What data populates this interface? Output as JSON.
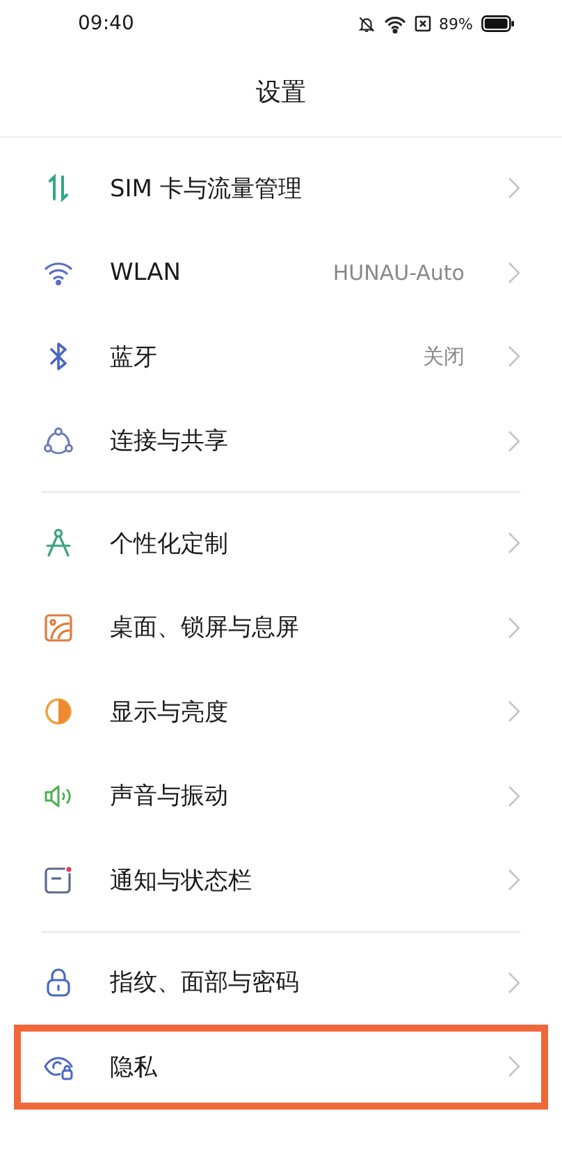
{
  "status_bar": {
    "time": "09:40",
    "battery": "89%"
  },
  "title": "设置",
  "groups": [
    {
      "items": [
        {
          "kind": "sim",
          "label": "SIM 卡与流量管理",
          "highlighted": false
        },
        {
          "kind": "wlan",
          "label": "WLAN",
          "value": "HUNAU-Auto",
          "highlighted": false
        },
        {
          "kind": "bluetooth",
          "label": "蓝牙",
          "value": "关闭",
          "highlighted": false
        },
        {
          "kind": "share",
          "label": "连接与共享",
          "highlighted": false
        }
      ]
    },
    {
      "items": [
        {
          "kind": "personalize",
          "label": "个性化定制",
          "highlighted": false
        },
        {
          "kind": "wallpaper",
          "label": "桌面、锁屏与息屏",
          "highlighted": false
        },
        {
          "kind": "display",
          "label": "显示与亮度",
          "highlighted": false
        },
        {
          "kind": "sound",
          "label": "声音与振动",
          "highlighted": false
        },
        {
          "kind": "notify",
          "label": "通知与状态栏",
          "highlighted": false
        }
      ]
    },
    {
      "items": [
        {
          "kind": "lock",
          "label": "指纹、面部与密码",
          "highlighted": false
        },
        {
          "kind": "privacy",
          "label": "隐私",
          "highlighted": true
        }
      ]
    }
  ]
}
